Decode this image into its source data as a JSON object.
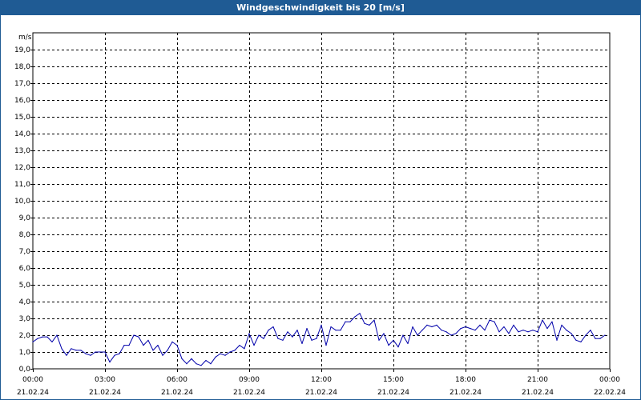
{
  "window": {
    "title": "Windgeschwindigkeit bis 20 [m/s]"
  },
  "chart_data": {
    "type": "line",
    "title": "Windgeschwindigkeit bis 20 [m/s]",
    "ylabel": "m/s",
    "xlabel": "",
    "ylim": [
      0,
      20
    ],
    "xlim": [
      0,
      24
    ],
    "grid": true,
    "line_color": "#0000aa",
    "y_ticks": [
      "0,0",
      "1,0",
      "2,0",
      "3,0",
      "4,0",
      "5,0",
      "6,0",
      "7,0",
      "8,0",
      "9,0",
      "10,0",
      "11,0",
      "12,0",
      "13,0",
      "14,0",
      "15,0",
      "16,0",
      "17,0",
      "18,0",
      "19,0"
    ],
    "x_ticks": [
      {
        "time": "00:00",
        "date": "21.02.24"
      },
      {
        "time": "03:00",
        "date": "21.02.24"
      },
      {
        "time": "06:00",
        "date": "21.02.24"
      },
      {
        "time": "09:00",
        "date": "21.02.24"
      },
      {
        "time": "12:00",
        "date": "21.02.24"
      },
      {
        "time": "15:00",
        "date": "21.02.24"
      },
      {
        "time": "18:00",
        "date": "21.02.24"
      },
      {
        "time": "21:00",
        "date": "21.02.24"
      },
      {
        "time": "00:00",
        "date": "22.02.24"
      }
    ],
    "series": [
      {
        "x": [
          0,
          0.2,
          0.4,
          0.6,
          0.8,
          1.0,
          1.2,
          1.4,
          1.6,
          1.8,
          2.0,
          2.2,
          2.4,
          2.6,
          2.8,
          3.0,
          3.2,
          3.4,
          3.6,
          3.8,
          4.0,
          4.2,
          4.4,
          4.6,
          4.8,
          5.0,
          5.2,
          5.4,
          5.6,
          5.8,
          6.0,
          6.2,
          6.4,
          6.6,
          6.8,
          7.0,
          7.2,
          7.4,
          7.6,
          7.8,
          8.0,
          8.2,
          8.4,
          8.6,
          8.8,
          9.0,
          9.2,
          9.4,
          9.6,
          9.8,
          10.0,
          10.2,
          10.4,
          10.6,
          10.8,
          11.0,
          11.2,
          11.4,
          11.6,
          11.8,
          12.0,
          12.2,
          12.4,
          12.6,
          12.8,
          13.0,
          13.2,
          13.4,
          13.6,
          13.8,
          14.0,
          14.2,
          14.4,
          14.6,
          14.8,
          15.0,
          15.2,
          15.4,
          15.6,
          15.8,
          16.0,
          16.2,
          16.4,
          16.6,
          16.8,
          17.0,
          17.2,
          17.4,
          17.6,
          17.8,
          18.0,
          18.2,
          18.4,
          18.6,
          18.8,
          19.0,
          19.2,
          19.4,
          19.6,
          19.8,
          20.0,
          20.2,
          20.4,
          20.6,
          20.8,
          21.0,
          21.2,
          21.4,
          21.6,
          21.8,
          22.0,
          22.2,
          22.4,
          22.6,
          22.8,
          23.0,
          23.2,
          23.4,
          23.6,
          23.8
        ],
        "values": [
          1.6,
          1.8,
          1.9,
          1.9,
          1.6,
          2.0,
          1.2,
          0.8,
          1.2,
          1.1,
          1.1,
          0.9,
          0.8,
          1.0,
          1.0,
          1.0,
          0.4,
          0.8,
          0.9,
          1.4,
          1.4,
          2.0,
          1.9,
          1.4,
          1.7,
          1.1,
          1.4,
          0.8,
          1.1,
          1.6,
          1.4,
          0.6,
          0.3,
          0.6,
          0.3,
          0.2,
          0.5,
          0.3,
          0.7,
          0.9,
          0.8,
          1.0,
          1.1,
          1.4,
          1.2,
          2.1,
          1.4,
          2.0,
          1.8,
          2.3,
          2.5,
          1.8,
          1.7,
          2.2,
          1.9,
          2.3,
          1.5,
          2.4,
          1.7,
          1.8,
          2.6,
          1.4,
          2.5,
          2.3,
          2.3,
          2.8,
          2.8,
          3.1,
          3.3,
          2.7,
          2.6,
          2.9,
          1.7,
          2.1,
          1.4,
          1.7,
          1.3,
          2.0,
          1.5,
          2.5,
          2.0,
          2.3,
          2.6,
          2.5,
          2.6,
          2.3,
          2.2,
          2.0,
          2.1,
          2.4,
          2.5,
          2.4,
          2.3,
          2.6,
          2.3,
          2.9,
          2.8,
          2.2,
          2.5,
          2.1,
          2.6,
          2.2,
          2.3,
          2.2,
          2.3,
          2.2,
          2.9,
          2.4,
          2.8,
          1.7,
          2.6,
          2.3,
          2.1,
          1.7,
          1.6,
          2.0,
          2.3,
          1.8,
          1.8,
          2.0
        ]
      }
    ]
  }
}
